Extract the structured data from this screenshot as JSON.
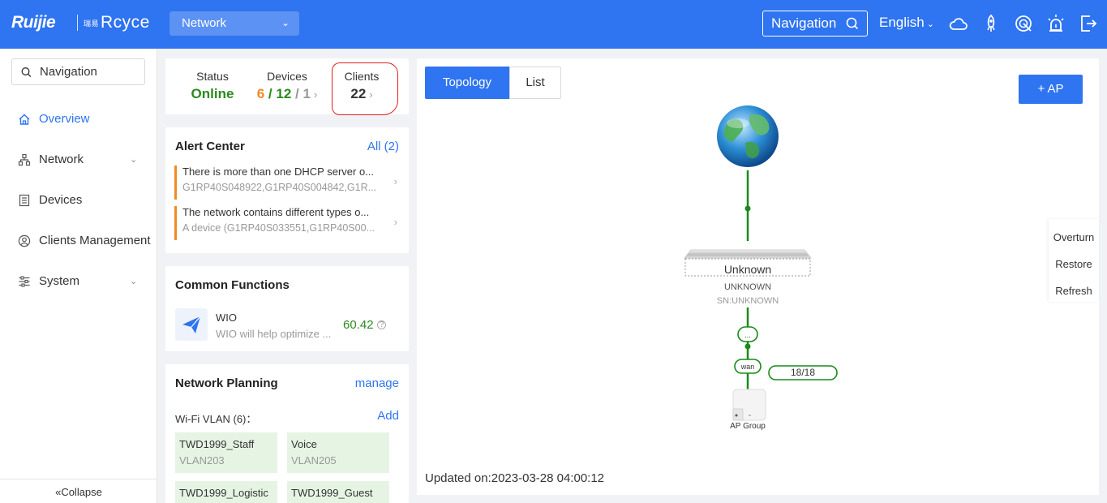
{
  "header": {
    "logo_brand": "Ruijie",
    "logo_sub_small": "瑞易",
    "logo_sub": "Rcyce",
    "network_select": "Network",
    "nav_button": "Navigation",
    "language": "English",
    "icons": [
      "cloud-icon",
      "rocket-icon",
      "diagnose-icon",
      "alarm-icon",
      "logout-icon"
    ],
    "color": "#2f74f0"
  },
  "sidebar": {
    "search_placeholder": "Navigation",
    "items": [
      {
        "label": "Overview",
        "icon": "home-icon",
        "active": true
      },
      {
        "label": "Network",
        "icon": "network-icon",
        "expandable": true
      },
      {
        "label": "Devices",
        "icon": "devices-icon"
      },
      {
        "label": "Clients Management",
        "icon": "user-icon"
      },
      {
        "label": "System",
        "icon": "settings-icon",
        "expandable": true
      }
    ],
    "collapse": "Collapse"
  },
  "status": {
    "status_label": "Status",
    "status_value": "Online",
    "devices_label": "Devices",
    "devices_a": "6",
    "devices_b": "12",
    "devices_c": "1",
    "sep": "/",
    "clients_label": "Clients",
    "clients_value": "22",
    "colors": {
      "online": "#2b8a1e",
      "devices_a": "#f08a24",
      "devices_b": "#2b8a1e",
      "devices_c": "#999999"
    }
  },
  "alerts": {
    "title": "Alert Center",
    "all_link": "All (2)",
    "items": [
      {
        "line1": "There is more than one DHCP server o...",
        "line2": "G1RP40S048922,G1RP40S004842,G1R..."
      },
      {
        "line1": "The network contains different types o...",
        "line2": "A device (G1RP40S033551,G1RP40S00..."
      }
    ]
  },
  "functions": {
    "title": "Common Functions",
    "wio_name": "WIO",
    "wio_desc": "WIO will help optimize ...",
    "wio_score": "60.42"
  },
  "planning": {
    "title": "Network Planning",
    "manage": "manage",
    "vlan_label": "Wi-Fi VLAN (6)：",
    "add": "Add",
    "vlans": [
      {
        "name": "TWD1999_Staff",
        "vlan": "VLAN203"
      },
      {
        "name": "Voice",
        "vlan": "VLAN205"
      },
      {
        "name": "TWD1999_Logistic",
        "vlan": ""
      },
      {
        "name": "TWD1999_Guest",
        "vlan": ""
      }
    ]
  },
  "topology": {
    "tab_topology": "Topology",
    "tab_list": "List",
    "ap_button": "+ AP",
    "switch_name": "Unknown",
    "switch_model": "UNKNOWN",
    "switch_sn": "SN:UNKNOWN",
    "port_more": "...",
    "port_wan": "wan",
    "ap_count": "18/18",
    "ap_group": "AP Group",
    "updated": "Updated on:2023-03-28 04:00:12",
    "tools": [
      "Overturn",
      "Restore",
      "Refresh"
    ],
    "link_color": "#1a8a1a"
  }
}
